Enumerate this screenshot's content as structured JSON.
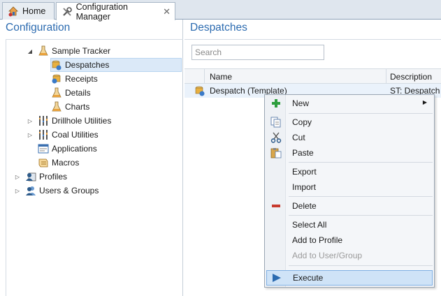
{
  "tabs": [
    {
      "label": "Home",
      "icon": "home-icon"
    },
    {
      "label": "Configuration Manager",
      "icon": "tools-icon",
      "close": "✕"
    }
  ],
  "left_panel": {
    "title": "Configuration",
    "tree": [
      {
        "label": "Sample Tracker",
        "icon": "flask-icon",
        "expand": "◢"
      },
      {
        "label": "Despatches",
        "icon": "despatch-icon"
      },
      {
        "label": "Receipts",
        "icon": "receipt-icon"
      },
      {
        "label": "Details",
        "icon": "flask-icon"
      },
      {
        "label": "Charts",
        "icon": "flask-icon"
      },
      {
        "label": "Drillhole Utilities",
        "icon": "drillhole-icon",
        "expand": "▷"
      },
      {
        "label": "Coal Utilities",
        "icon": "drillhole-icon",
        "expand": "▷"
      },
      {
        "label": "Applications",
        "icon": "applications-icon"
      },
      {
        "label": "Macros",
        "icon": "macros-icon"
      },
      {
        "label": "Profiles",
        "icon": "profiles-icon",
        "expand": "▷"
      },
      {
        "label": "Users & Groups",
        "icon": "users-icon",
        "expand": "▷"
      }
    ]
  },
  "right_panel": {
    "title": "Despatches",
    "search": {
      "placeholder": "Search"
    },
    "columns": [
      "Name",
      "Description"
    ],
    "rows": [
      {
        "name": "Despatch (Template)",
        "description": "ST: Despatch"
      }
    ]
  },
  "context_menu": {
    "items": [
      {
        "label": "New",
        "icon": "plus-icon",
        "submenu": "▶"
      },
      {
        "label": "Copy",
        "icon": "copy-icon"
      },
      {
        "label": "Cut",
        "icon": "scissors-icon"
      },
      {
        "label": "Paste",
        "icon": "paste-icon"
      },
      {
        "label": "Export"
      },
      {
        "label": "Import"
      },
      {
        "label": "Delete",
        "icon": "minus-icon"
      },
      {
        "label": "Select All"
      },
      {
        "label": "Add to Profile"
      },
      {
        "label": "Add to User/Group",
        "disabled": true
      },
      {
        "label": "Execute",
        "icon": "play-icon",
        "highlighted": true
      }
    ]
  },
  "colors": {
    "accent_title": "#2c6bb0",
    "selection": "#dbe9f8",
    "menu_highlight": "#cfe3f7"
  }
}
